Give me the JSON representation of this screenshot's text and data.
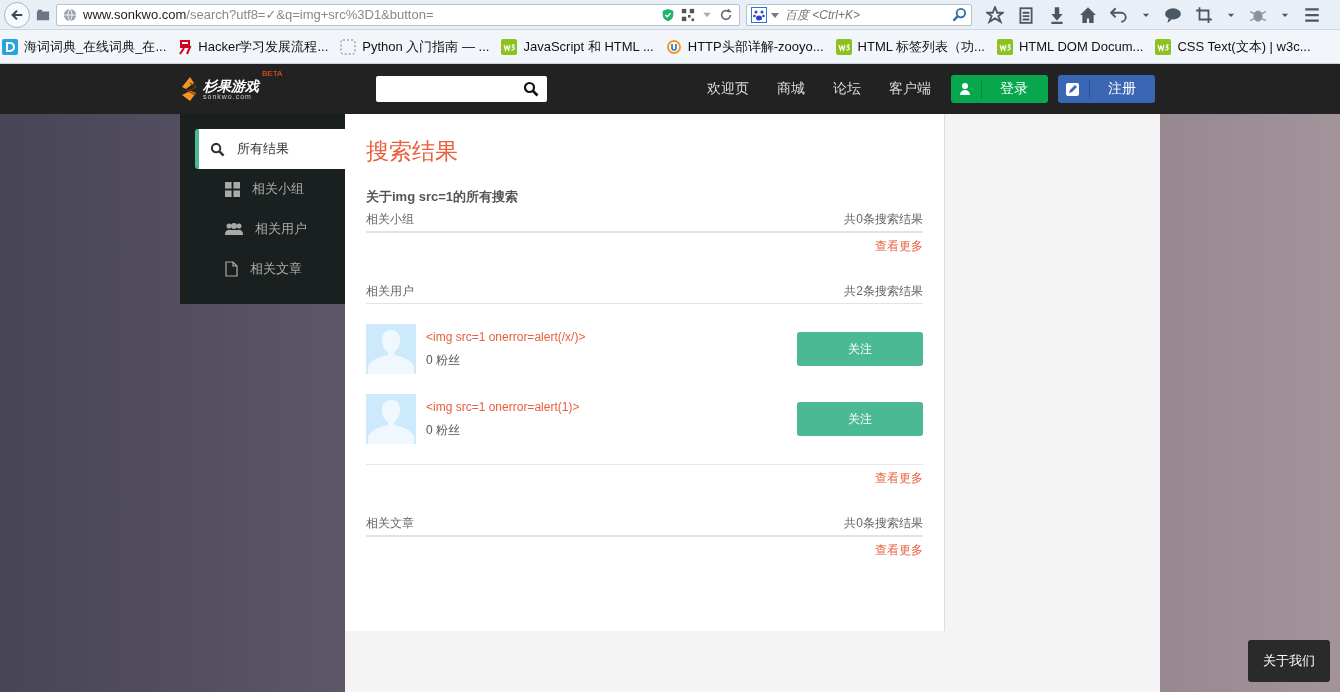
{
  "browser": {
    "url_host": "www.sonkwo.com",
    "url_path": "/search?utf8=✓&q=img+src%3D1&button=",
    "search_placeholder": "百度 <Ctrl+K>"
  },
  "bookmarks": [
    {
      "label": "海词词典_在线词典_在...",
      "kind": "dict"
    },
    {
      "label": "Hacker学习发展流程...",
      "kind": "red"
    },
    {
      "label": "Python 入门指南 — ...",
      "kind": "blank"
    },
    {
      "label": "JavaScript 和 HTML ...",
      "kind": "w3c"
    },
    {
      "label": "HTTP头部详解-zooyo...",
      "kind": "ring"
    },
    {
      "label": "HTML 标签列表（功...",
      "kind": "w3c"
    },
    {
      "label": "HTML DOM Docum...",
      "kind": "w3c"
    },
    {
      "label": "CSS Text(文本) | w3c...",
      "kind": "w3c"
    }
  ],
  "header": {
    "logo_name": "杉果游戏",
    "logo_domain": "sonkwo.com",
    "logo_badge": "BETA",
    "nav": [
      "欢迎页",
      "商城",
      "论坛",
      "客户端"
    ],
    "login": "登录",
    "register": "注册"
  },
  "sidebar": [
    {
      "label": "所有结果",
      "kind": "search",
      "selected": true
    },
    {
      "label": "相关小组",
      "kind": "grid",
      "selected": false
    },
    {
      "label": "相关用户",
      "kind": "users",
      "selected": false
    },
    {
      "label": "相关文章",
      "kind": "file",
      "selected": false
    }
  ],
  "results": {
    "title": "搜索结果",
    "query_heading": "关于img src=1的所有搜索",
    "sections": [
      {
        "name": "相关小组",
        "count": "共0条搜索结果",
        "more": "查看更多"
      },
      {
        "name": "相关用户",
        "count": "共2条搜索结果",
        "more": "查看更多",
        "users": [
          {
            "name": "<img src=1 onerror=alert(/x/)>",
            "fans": "0 粉丝",
            "follow": "关注"
          },
          {
            "name": "<img src=1 onerror=alert(1)>",
            "fans": "0 粉丝",
            "follow": "关注"
          }
        ]
      },
      {
        "name": "相关文章",
        "count": "共0条搜索结果",
        "more": "查看更多"
      }
    ]
  },
  "footer_button": "关于我们"
}
